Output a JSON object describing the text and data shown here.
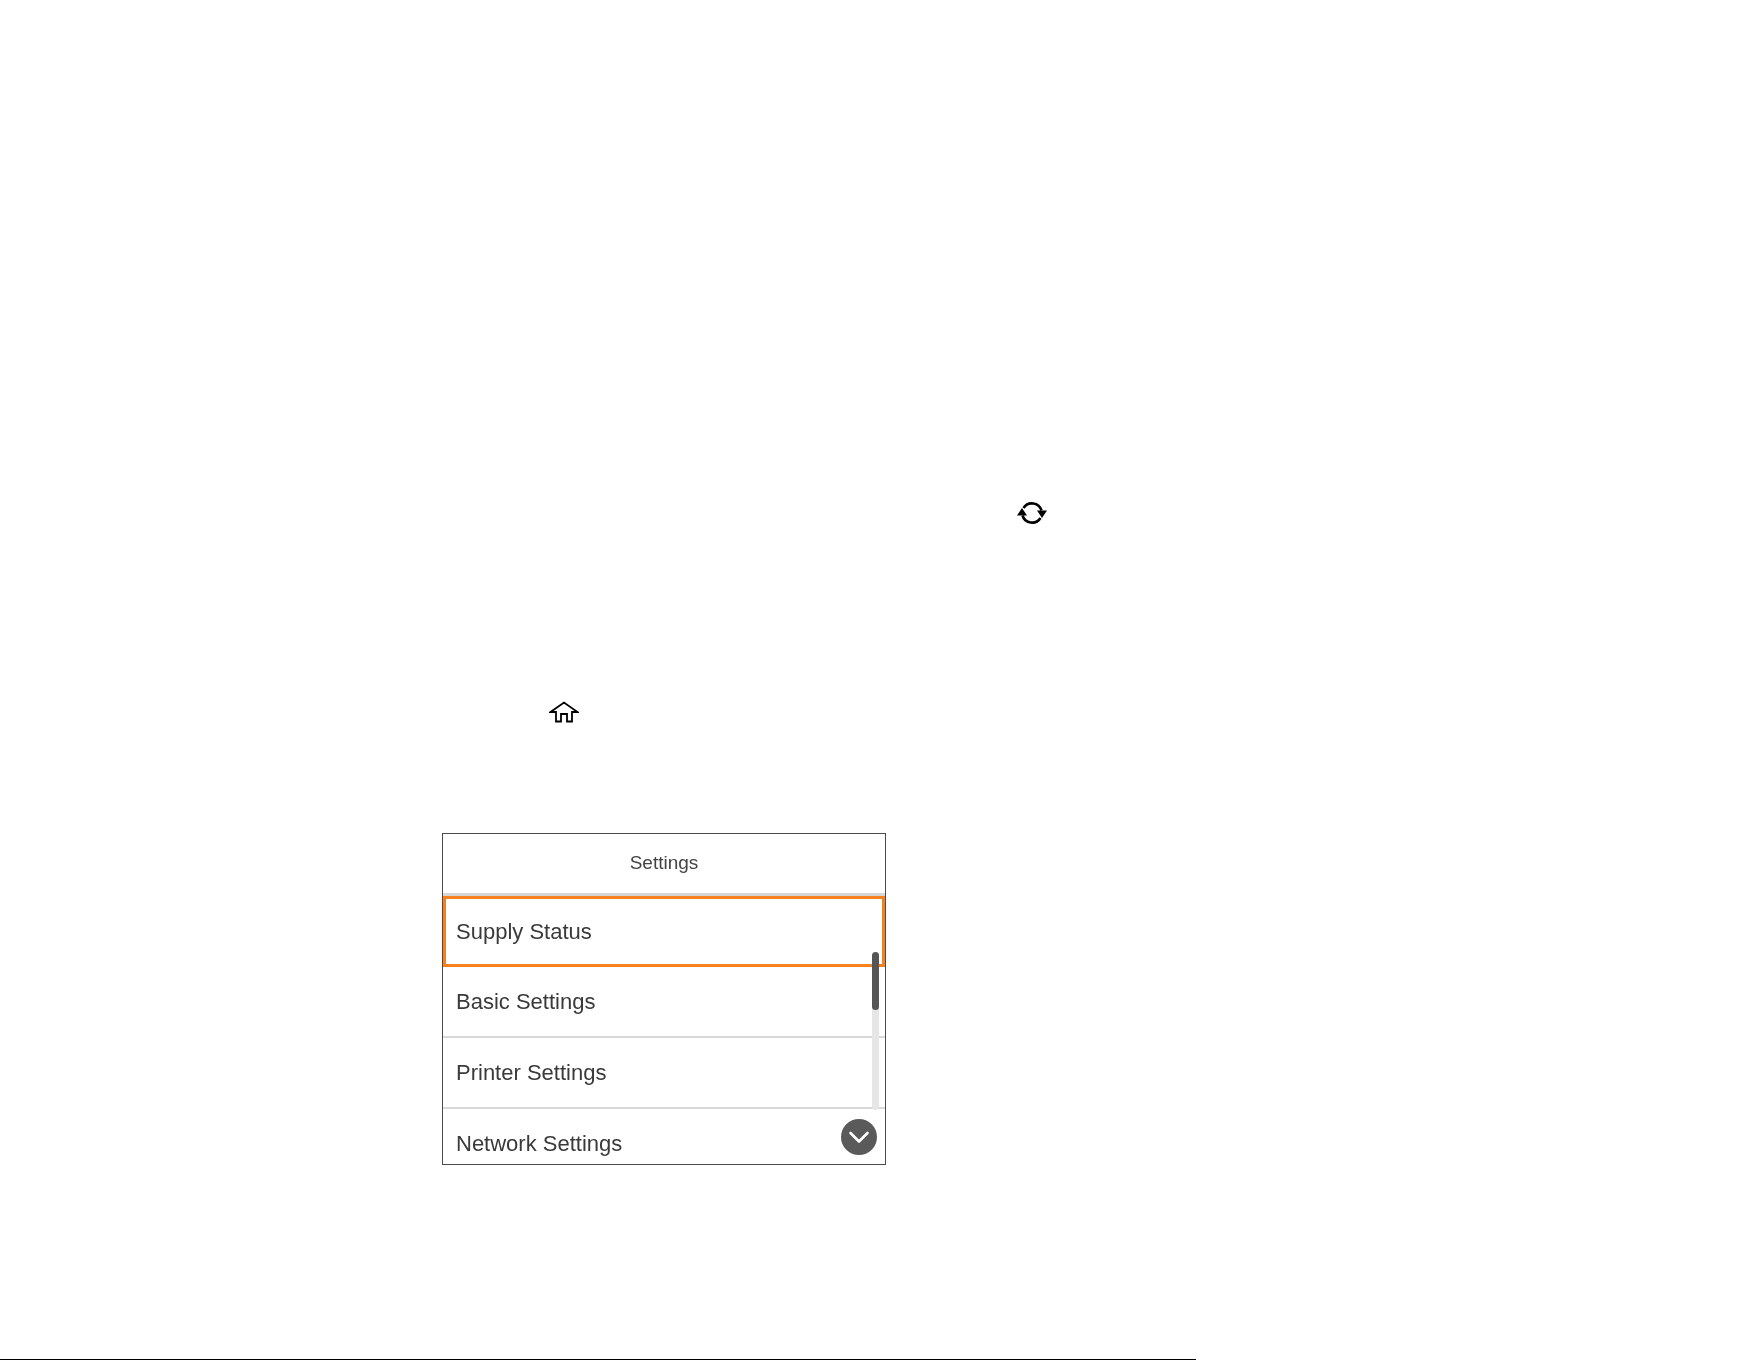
{
  "settings_menu": {
    "title": "Settings",
    "items": [
      {
        "label": "Supply Status",
        "selected": true
      },
      {
        "label": "Basic Settings",
        "selected": false
      },
      {
        "label": "Printer Settings",
        "selected": false
      },
      {
        "label": "Network Settings",
        "selected": false
      }
    ]
  }
}
